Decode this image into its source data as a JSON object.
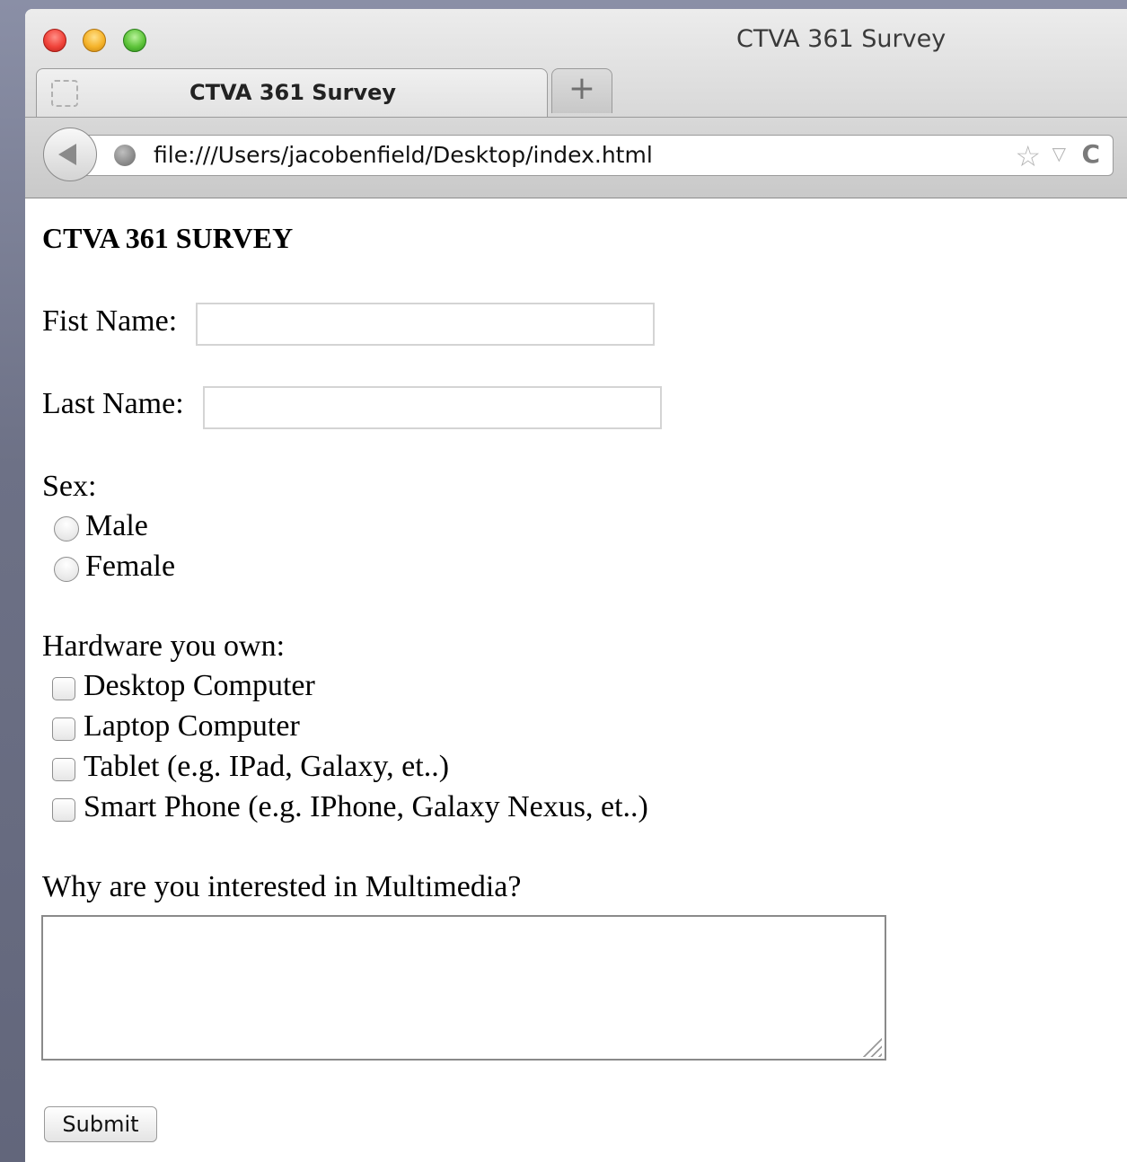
{
  "window": {
    "title": "CTVA 361 Survey"
  },
  "tabs": [
    {
      "label": "CTVA 361 Survey",
      "active": true
    }
  ],
  "new_tab_glyph": "+",
  "toolbar": {
    "back_icon": "back-arrow-icon",
    "url": "file:///Users/jacobenfield/Desktop/index.html",
    "bookmark_icon": "star-icon",
    "dropdown_glyph": "▽",
    "star_glyph": "☆",
    "reload_glyph": "C"
  },
  "page": {
    "title": "CTVA 361 SURVEY",
    "first_name": {
      "label": "Fist Name:",
      "value": ""
    },
    "last_name": {
      "label": "Last Name:",
      "value": ""
    },
    "sex": {
      "label": "Sex:",
      "options": [
        "Male",
        "Female"
      ],
      "selected": null
    },
    "hardware": {
      "label": "Hardware you own:",
      "options": [
        "Desktop Computer",
        "Laptop Computer",
        "Tablet (e.g. IPad, Galaxy, et..)",
        "Smart Phone (e.g. IPhone, Galaxy Nexus, et..)"
      ],
      "checked": [
        false,
        false,
        false,
        false
      ]
    },
    "interest": {
      "label": "Why are you interested in Multimedia?",
      "value": ""
    },
    "submit_label": "Submit"
  },
  "colors": {
    "chrome_bg": "#d9d9d9",
    "page_bg": "#ffffff",
    "traffic_red": "#f0433a",
    "traffic_yellow": "#f5b32a",
    "traffic_green": "#5ec43a"
  }
}
